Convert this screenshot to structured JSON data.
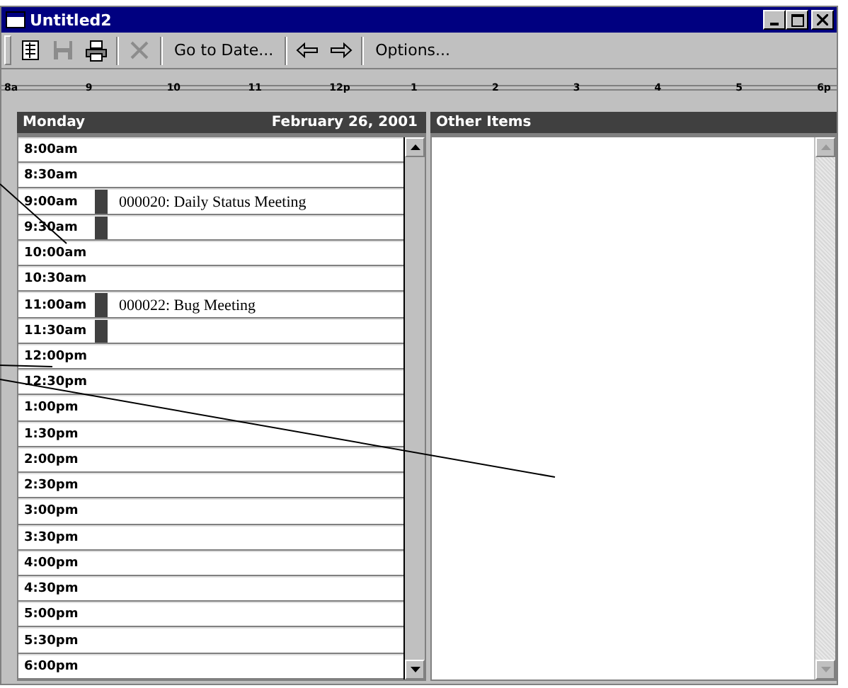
{
  "window": {
    "title": "Untitled2"
  },
  "toolbar": [
    {
      "kind": "calendar",
      "disabled": false
    },
    {
      "kind": "save",
      "disabled": true
    },
    {
      "kind": "print",
      "disabled": false
    },
    {
      "kind": "separator"
    },
    {
      "kind": "delete",
      "disabled": true
    },
    {
      "kind": "separator"
    },
    {
      "kind": "text",
      "label": "Go to Date..."
    },
    {
      "kind": "separator"
    },
    {
      "kind": "back",
      "disabled": false
    },
    {
      "kind": "forward",
      "disabled": false
    },
    {
      "kind": "separator"
    },
    {
      "kind": "text",
      "label": "Options..."
    }
  ],
  "ruler": [
    "8a",
    "9",
    "10",
    "11",
    "12p",
    "1",
    "2",
    "3",
    "4",
    "5",
    "6p"
  ],
  "day_view": {
    "day": "Monday",
    "date": "February 26, 2001",
    "slots": [
      {
        "time": "8:00am",
        "busy": false
      },
      {
        "time": "8:30am",
        "busy": false
      },
      {
        "time": "9:00am",
        "busy": true,
        "appointment": "000020: Daily Status Meeting"
      },
      {
        "time": "9:30am",
        "busy": true
      },
      {
        "time": "10:00am",
        "busy": false
      },
      {
        "time": "10:30am",
        "busy": false
      },
      {
        "time": "11:00am",
        "busy": true,
        "appointment": "000022: Bug Meeting"
      },
      {
        "time": "11:30am",
        "busy": true
      },
      {
        "time": "12:00pm",
        "busy": false
      },
      {
        "time": "12:30pm",
        "busy": false
      },
      {
        "time": "1:00pm",
        "busy": false
      },
      {
        "time": "1:30pm",
        "busy": false
      },
      {
        "time": "2:00pm",
        "busy": false
      },
      {
        "time": "2:30pm",
        "busy": false
      },
      {
        "time": "3:00pm",
        "busy": false
      },
      {
        "time": "3:30pm",
        "busy": false
      },
      {
        "time": "4:00pm",
        "busy": false
      },
      {
        "time": "4:30pm",
        "busy": false
      },
      {
        "time": "5:00pm",
        "busy": false
      },
      {
        "time": "5:30pm",
        "busy": false
      },
      {
        "time": "6:00pm",
        "busy": false
      }
    ]
  },
  "other_items": {
    "title": "Other Items"
  }
}
